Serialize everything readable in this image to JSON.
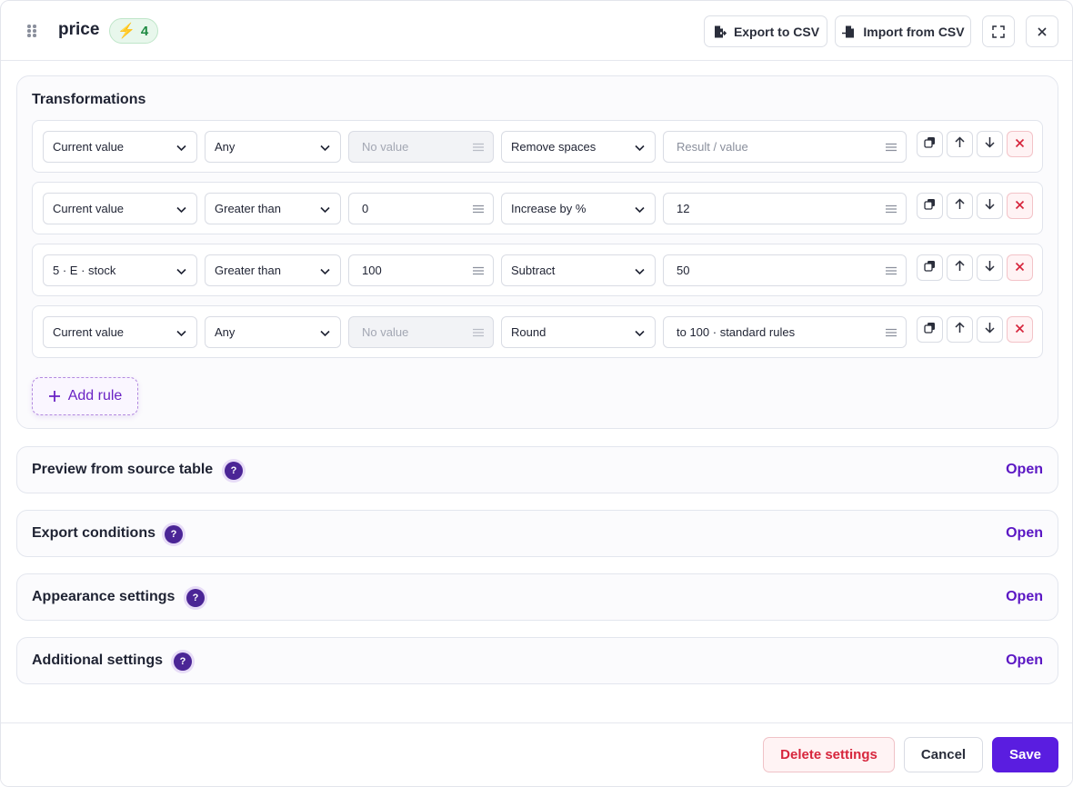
{
  "header": {
    "title": "price",
    "badge_count": "4",
    "badge_icon": "lightning-icon",
    "export_label": "Export to CSV",
    "import_label": "Import from CSV"
  },
  "transformations": {
    "title": "Transformations",
    "rules": [
      {
        "source": "Current value",
        "condition": "Any",
        "value": "No value",
        "value_disabled": true,
        "action": "Remove spaces",
        "result": "Result / value",
        "result_placeholder": true
      },
      {
        "source": "Current value",
        "condition": "Greater than",
        "value": "0",
        "value_disabled": false,
        "action": "Increase by %",
        "result": "12",
        "result_placeholder": false
      },
      {
        "source": "5 · E · stock",
        "condition": "Greater than",
        "value": "100",
        "value_disabled": false,
        "action": "Subtract",
        "result": "50",
        "result_placeholder": false
      },
      {
        "source": "Current value",
        "condition": "Any",
        "value": "No value",
        "value_disabled": true,
        "action": "Round",
        "result": "to 100 · standard rules",
        "result_placeholder": false
      }
    ],
    "add_rule_label": "Add rule"
  },
  "sections": [
    {
      "title": "Preview from source table",
      "help": "?",
      "action": "Open"
    },
    {
      "title": "Export conditions",
      "help": "?",
      "action": "Open"
    },
    {
      "title": "Appearance settings",
      "help": "?",
      "action": "Open"
    },
    {
      "title": "Additional settings",
      "help": "?",
      "action": "Open"
    }
  ],
  "footer": {
    "delete_label": "Delete settings",
    "cancel_label": "Cancel",
    "save_label": "Save"
  },
  "colors": {
    "accent": "#5a1de0",
    "danger": "#d7263d",
    "success": "#1f8a43"
  }
}
